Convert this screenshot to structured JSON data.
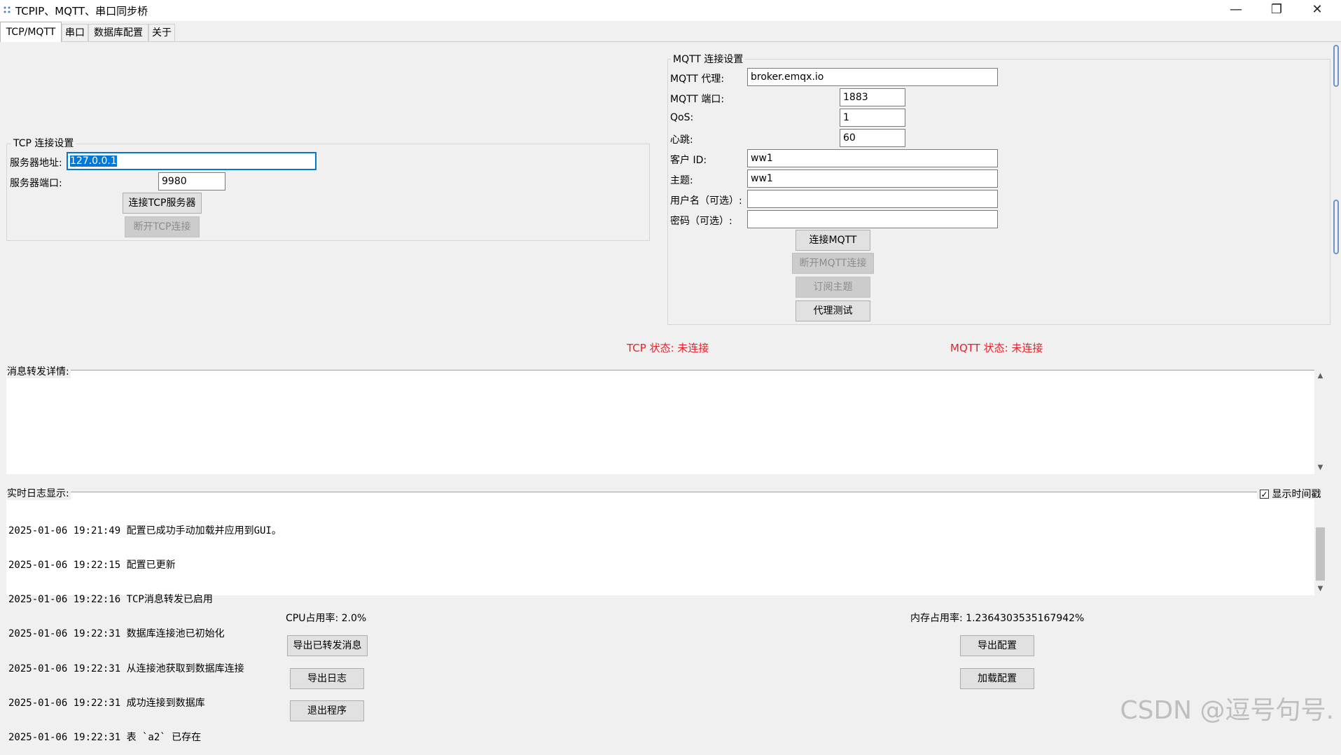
{
  "window": {
    "title": "TCPIP、MQTT、串口同步桥",
    "controls": {
      "minimize": "—",
      "restore": "❐",
      "close": "✕"
    }
  },
  "tabs": [
    {
      "label": "TCP/MQTT"
    },
    {
      "label": "串口"
    },
    {
      "label": "数据库配置"
    },
    {
      "label": "关于"
    }
  ],
  "tcp": {
    "group_title": "TCP 连接设置",
    "server_address_label": "服务器地址:",
    "server_address_value": "127.0.0.1",
    "server_port_label": "服务器端口:",
    "server_port_value": "9980",
    "connect_button": "连接TCP服务器",
    "disconnect_button": "断开TCP连接"
  },
  "mqtt": {
    "group_title": "MQTT 连接设置",
    "broker_label": "MQTT 代理:",
    "broker_value": "broker.emqx.io",
    "port_label": "MQTT 端口:",
    "port_value": "1883",
    "qos_label": "QoS:",
    "qos_value": "1",
    "heartbeat_label": "心跳:",
    "heartbeat_value": "60",
    "client_id_label": "客户 ID:",
    "client_id_value": "ww1",
    "topic_label": "主题:",
    "topic_value": "ww1",
    "username_label": "用户名（可选）:",
    "username_value": "",
    "password_label": "密码（可选）:",
    "password_value": "",
    "connect_button": "连接MQTT",
    "disconnect_button": "断开MQTT连接",
    "subscribe_button": "订阅主题",
    "proxy_test_button": "代理测试"
  },
  "status": {
    "tcp": "TCP 状态: 未连接",
    "mqtt": "MQTT 状态: 未连接",
    "status_color": "#e8202a"
  },
  "forward": {
    "label": "消息转发详情:"
  },
  "log": {
    "label": "实时日志显示:",
    "show_timestamp_label": "显示时间戳",
    "show_timestamp_checked": true,
    "lines": [
      "2025-01-06 19:21:49 配置已成功手动加载并应用到GUI。",
      "2025-01-06 19:22:15 配置已更新",
      "2025-01-06 19:22:16 TCP消息转发已启用",
      "2025-01-06 19:22:31 数据库连接池已初始化",
      "2025-01-06 19:22:31 从连接池获取到数据库连接",
      "2025-01-06 19:22:31 成功连接到数据库",
      "2025-01-06 19:22:31 表 `a2` 已存在"
    ]
  },
  "footer": {
    "cpu_usage": "CPU占用率: 2.0%",
    "memory_usage": "内存占用率: 1.2364303535167942%",
    "export_forwarded_button": "导出已转发消息",
    "export_log_button": "导出日志",
    "exit_button": "退出程序",
    "export_config_button": "导出配置",
    "load_config_button": "加载配置"
  },
  "watermark": "CSDN @逗号句号.",
  "icons": {
    "app": "app-icon",
    "checkbox": "checkbox-checked-icon",
    "scroll_up": "scroll-up-arrow-icon",
    "scroll_down": "scroll-down-arrow-icon"
  }
}
